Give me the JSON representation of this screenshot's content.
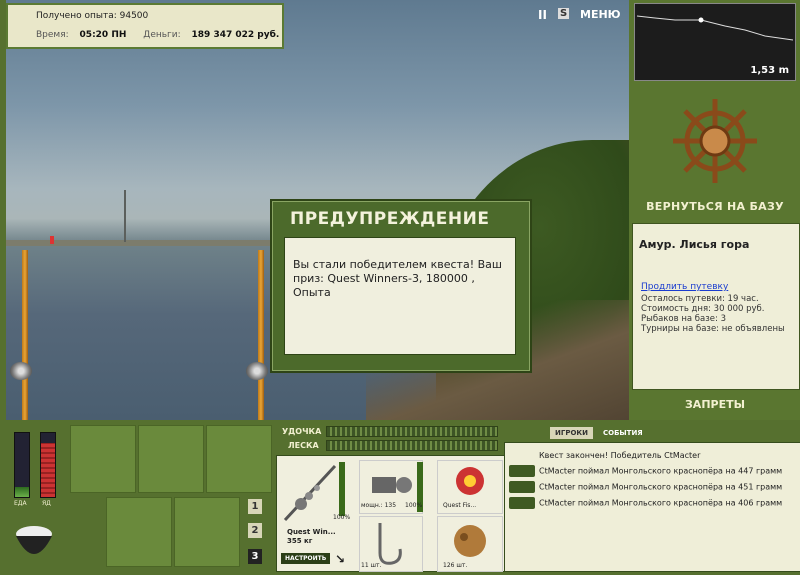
{
  "hud": {
    "experience_label": "Получено опыта:",
    "experience_value": "94500",
    "time_label": "Время:",
    "time_value": "05:20 ПН",
    "money_label": "Деньги:",
    "money_value": "189 347 022 руб."
  },
  "top_icons": {
    "pause_label": "II",
    "sound_label": "S",
    "menu_label": "МЕНЮ"
  },
  "depth_panel": {
    "depth_value": "1,53 m"
  },
  "base": {
    "return_label": "ВЕРНУТЬСЯ НА БАЗУ",
    "location_title": "Амур. Лисья гора",
    "extend_link": "Продлить путевку",
    "remaining": "Осталось путевки: 19 час.",
    "day_cost": "Стоимость дня: 30 000 руб.",
    "fishers": "Рыбаков на базе: 3",
    "tournaments": "Турниры на базе: не объявлены",
    "bans_label": "ЗАПРЕТЫ"
  },
  "dialog": {
    "title": "ПРЕДУПРЕЖДЕНИЕ",
    "message": "Вы стали победителем квеста! Ваш приз: Quest Winners-3, 180000 , Опыта"
  },
  "status_bars": {
    "food_label": "ЕДА",
    "poison_label": "ЯД",
    "food_level": 0.15,
    "poison_level": 0.85
  },
  "tackle_bars": {
    "rod_label": "УДОЧКА",
    "line_label": "ЛЕСКА"
  },
  "tackle": {
    "rod_name": "Quest Win...",
    "rod_weight": "355 кг",
    "rod_percent": "100%",
    "reel_power": "мощн.: 135",
    "reel_percent": "100%",
    "line_name": "Quest Fis...",
    "hook_count": "11 шт.",
    "bait_count": "126 шт.",
    "setup_label": "НАСТРОИТЬ"
  },
  "pages": [
    "1",
    "2",
    "3"
  ],
  "events": {
    "tab_players": "ИГРОКИ",
    "tab_events": "СОБЫТИЯ",
    "items": [
      "Квест закончен! Победитель CtMacter",
      "CtMacter поймал Монгольского краснопёра на 447 грамм",
      "CtMacter поймал Монгольского краснопёра на 451 грамм",
      "CtMacter поймал Монгольского краснопёра на 406 грамм"
    ]
  },
  "colors": {
    "panel_green": "#56702f",
    "paper": "#efeed8",
    "accent_text": "#f2f0d0"
  }
}
